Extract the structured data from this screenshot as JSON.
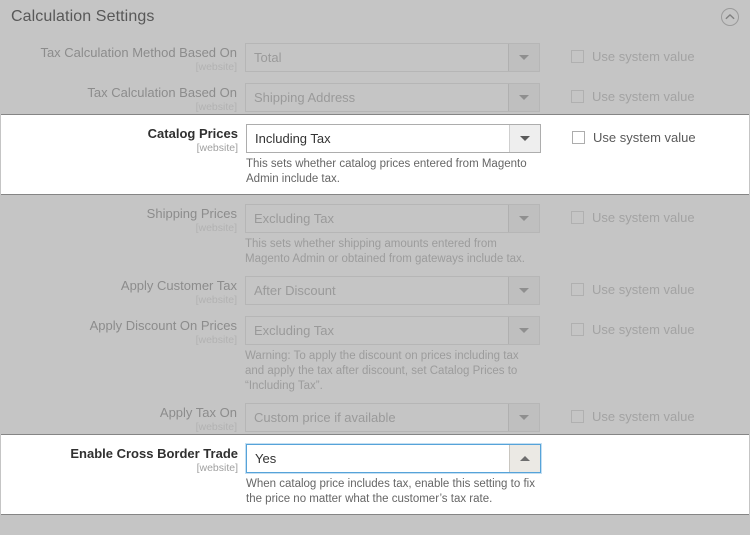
{
  "header": {
    "title": "Calculation Settings",
    "collapse_icon": "chevron-up-circle-icon"
  },
  "system_value_label": "Use system value",
  "scope_label": "[website]",
  "colors": {
    "page_background": "#c5c5c5",
    "highlight_background": "#ffffff",
    "focus_border": "#56a3d9",
    "title_text": "#585858",
    "muted_text": "#9a9a9a"
  },
  "fields": [
    {
      "label": "Tax Calculation Method Based On",
      "scope": "[website]",
      "value": "Total",
      "note": "",
      "state": "disabled",
      "arrow": "down",
      "use_system_value": "Use system value",
      "checked": false
    },
    {
      "label": "Tax Calculation Based On",
      "scope": "[website]",
      "value": "Shipping Address",
      "note": "",
      "state": "disabled",
      "arrow": "down",
      "use_system_value": "Use system value",
      "checked": false
    },
    {
      "label": "Catalog Prices",
      "scope": "[website]",
      "value": "Including Tax",
      "note": "This sets whether catalog prices entered from Magento Admin include tax.",
      "state": "highlight",
      "arrow": "down",
      "use_system_value": "Use system value",
      "checked": false
    },
    {
      "label": "Shipping Prices",
      "scope": "[website]",
      "value": "Excluding Tax",
      "note": "This sets whether shipping amounts entered from Magento Admin or obtained from gateways include tax.",
      "state": "disabled",
      "arrow": "down",
      "use_system_value": "Use system value",
      "checked": false
    },
    {
      "label": "Apply Customer Tax",
      "scope": "[website]",
      "value": "After Discount",
      "note": "",
      "state": "disabled",
      "arrow": "down",
      "use_system_value": "Use system value",
      "checked": false
    },
    {
      "label": "Apply Discount On Prices",
      "scope": "[website]",
      "value": "Excluding Tax",
      "note": "Warning: To apply the discount on prices including tax and apply the tax after discount, set Catalog Prices to “Including Tax”.",
      "state": "disabled",
      "arrow": "down",
      "use_system_value": "Use system value",
      "checked": false
    },
    {
      "label": "Apply Tax On",
      "scope": "[website]",
      "value": "Custom price if available",
      "note": "",
      "state": "disabled",
      "arrow": "down",
      "use_system_value": "Use system value",
      "checked": false
    },
    {
      "label": "Enable Cross Border Trade",
      "scope": "[website]",
      "value": "Yes",
      "note": "When catalog price includes tax, enable this setting to fix the price no matter what the customer’s tax rate.",
      "state": "focused",
      "arrow": "up",
      "use_system_value": "",
      "checked": false
    }
  ]
}
